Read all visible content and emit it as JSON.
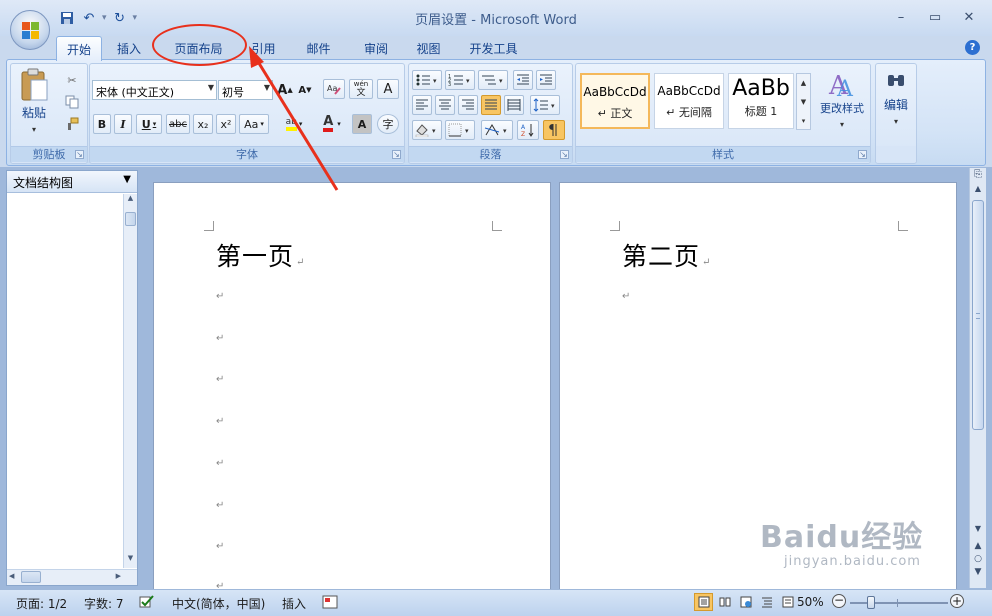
{
  "window": {
    "title": "页眉设置 - Microsoft Word",
    "controls": {
      "minimize": "–",
      "maximize": "▭",
      "close": "✕"
    }
  },
  "quick_access": {
    "save_icon": "save-icon",
    "undo_icon": "undo-icon",
    "redo_icon": "redo-icon",
    "customize": "▾"
  },
  "tabs": [
    {
      "label": "开始",
      "active": true
    },
    {
      "label": "插入",
      "active": false
    },
    {
      "label": "页面布局",
      "active": false
    },
    {
      "label": "引用",
      "active": false
    },
    {
      "label": "邮件",
      "active": false
    },
    {
      "label": "审阅",
      "active": false
    },
    {
      "label": "视图",
      "active": false
    },
    {
      "label": "开发工具",
      "active": false
    }
  ],
  "ribbon": {
    "clipboard": {
      "label": "剪贴板",
      "paste_label": "粘贴"
    },
    "font": {
      "label": "字体",
      "font_name": "宋体 (中文正文)",
      "font_size": "初号",
      "bold": "B",
      "italic": "I",
      "underline": "U",
      "strike": "abc",
      "subscript": "x₂",
      "superscript": "x²",
      "change_case": "Aa",
      "grow": "A",
      "shrink": "A",
      "phonetic": "wén",
      "border_char": "A",
      "enclose_char": "字",
      "text_color": "A",
      "shading": "A",
      "highlight": "ab"
    },
    "paragraph": {
      "label": "段落"
    },
    "styles": {
      "label": "样式",
      "items": [
        {
          "sample": "AaBbCcDd",
          "name": "↵ 正文"
        },
        {
          "sample": "AaBbCcDd",
          "name": "↵ 无间隔"
        },
        {
          "sample": "AaBb",
          "name": "标题 1"
        }
      ],
      "change_styles": "更改样式"
    },
    "editing": {
      "label": "编辑"
    }
  },
  "doc_map": {
    "label": "文档结构图"
  },
  "pages": [
    {
      "title": "第一页",
      "empty_paragraphs": 7
    },
    {
      "title": "第二页",
      "empty_paragraphs": 1
    }
  ],
  "statusbar": {
    "page": "页面: 1/2",
    "words": "字数: 7",
    "language": "中文(简体，中国)",
    "mode": "插入",
    "zoom": "50%"
  },
  "watermark": {
    "brand": "Baidu经验",
    "url": "jingyan.baidu.com"
  },
  "annotation": {
    "color": "#e8301c"
  }
}
